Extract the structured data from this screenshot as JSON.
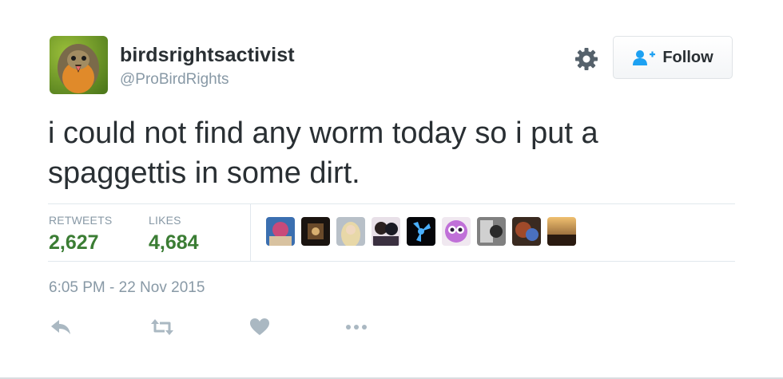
{
  "user": {
    "display_name": "birdsrightsactivist",
    "handle": "@ProBirdRights",
    "avatar_icon": "robin-avatar"
  },
  "header": {
    "settings_icon": "gear-icon",
    "follow_label": "Follow",
    "follow_icon": "follow-user-icon"
  },
  "tweet": {
    "text": "i could not find any worm today so i put a spaggettis in some dirt."
  },
  "stats": {
    "retweets_label": "RETWEETS",
    "retweets_value": "2,627",
    "likes_label": "LIKES",
    "likes_value": "4,684"
  },
  "likers": [
    {
      "icon": "liker-avatar"
    },
    {
      "icon": "liker-avatar"
    },
    {
      "icon": "liker-avatar"
    },
    {
      "icon": "liker-avatar"
    },
    {
      "icon": "liker-avatar"
    },
    {
      "icon": "liker-avatar"
    },
    {
      "icon": "liker-avatar"
    },
    {
      "icon": "liker-avatar"
    },
    {
      "icon": "liker-avatar"
    }
  ],
  "meta": {
    "timestamp": "6:05 PM - 22 Nov 2015"
  },
  "actions": [
    {
      "icon": "reply-icon"
    },
    {
      "icon": "retweet-icon"
    },
    {
      "icon": "like-icon"
    },
    {
      "icon": "more-icon"
    }
  ],
  "colors": {
    "stat_value": "#3b7d34",
    "muted_text": "#8899a6",
    "primary_text": "#292f33",
    "follow_icon": "#1da1f2",
    "action_icon": "#aab8c2"
  }
}
